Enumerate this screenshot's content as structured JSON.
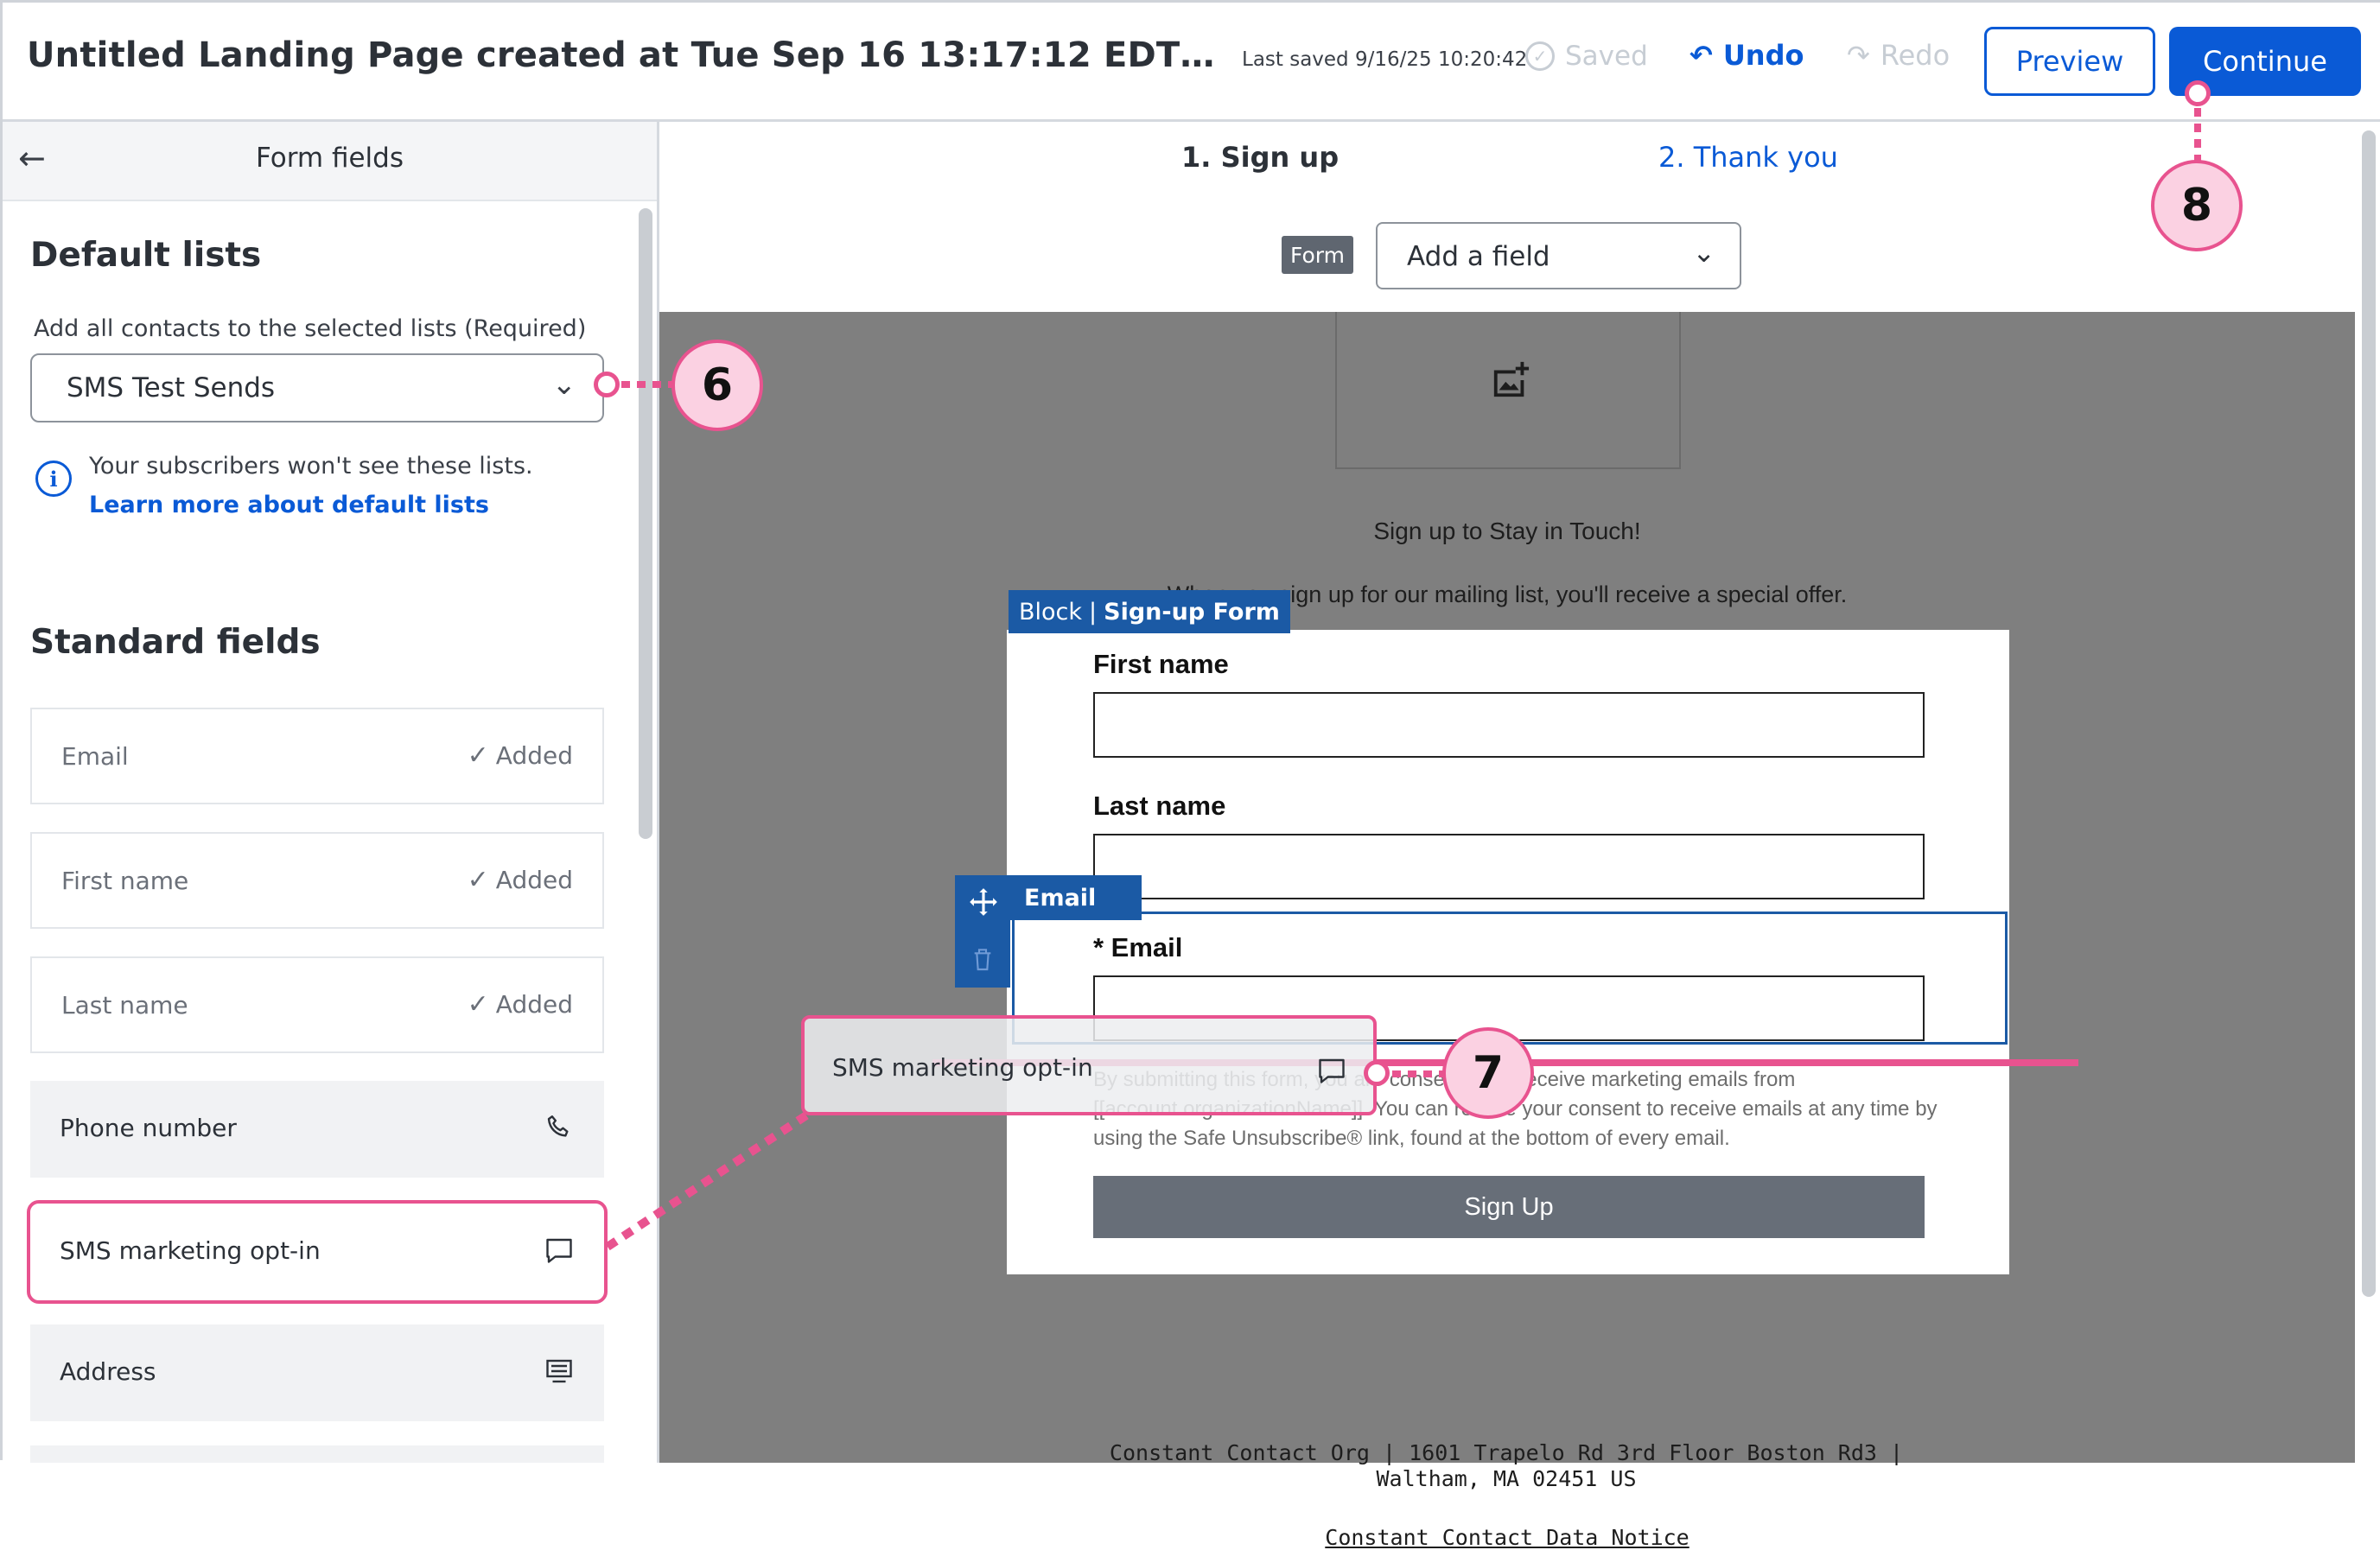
{
  "header": {
    "page_title": "Untitled Landing Page created at Tue Sep 16 13:17:12 EDT…",
    "last_saved": "Last saved 9/16/25 10:20:42",
    "saved_label": "Saved",
    "undo_label": "Undo",
    "redo_label": "Redo",
    "preview_label": "Preview",
    "continue_label": "Continue"
  },
  "left_panel": {
    "title": "Form fields",
    "default_lists": {
      "heading": "Default lists",
      "label": "Add all contacts to the selected lists  (Required)",
      "selected": "SMS Test Sends",
      "info_text": "Your subscribers won't see these lists. ",
      "info_link": "Learn more about default lists"
    },
    "standard_fields": {
      "heading": "Standard fields",
      "added_label": "Added",
      "added": [
        {
          "label": "Email"
        },
        {
          "label": "First name"
        },
        {
          "label": "Last name"
        }
      ],
      "available": [
        {
          "label": "Phone number",
          "icon": "phone-icon"
        },
        {
          "label": "SMS marketing opt-in",
          "icon": "chat-bubble-icon"
        },
        {
          "label": "Address",
          "icon": "address-card-icon"
        }
      ]
    }
  },
  "editor": {
    "steps": [
      {
        "label": "1.  Sign up",
        "active": true
      },
      {
        "label": "2.  Thank you",
        "active": false
      }
    ],
    "form_tag": "Form",
    "add_field_placeholder": "Add a field",
    "canvas": {
      "headline": "Sign up to Stay in Touch!",
      "subline": "When you sign up for our mailing list, you'll receive a special offer.",
      "block_tag_prefix": "Block",
      "block_tag_name": "Sign-up Form",
      "fields": {
        "first_name": "First name",
        "last_name": "Last name",
        "email": "* Email",
        "email_tag": "Email"
      },
      "disclaimer": "By submitting this form, you are consenting to receive marketing emails from [[account.organizationName]]. You can revoke your consent to receive emails at any time by using the Safe Unsubscribe® link, found at the bottom of every email.",
      "signup_button": "Sign Up",
      "footer_address": "Constant Contact Org | 1601 Trapelo Rd 3rd Floor Boston Rd3 | Waltham, MA 02451 US",
      "footer_link": "Constant Contact Data Notice"
    },
    "drag_ghost": {
      "label": "SMS marketing opt-in",
      "icon": "chat-bubble-icon"
    }
  },
  "callouts": {
    "c6": "6",
    "c7": "7",
    "c8": "8"
  },
  "colors": {
    "accent": "#0a5ad6",
    "highlight": "#e8538f",
    "block_blue": "#1b5aa5"
  }
}
